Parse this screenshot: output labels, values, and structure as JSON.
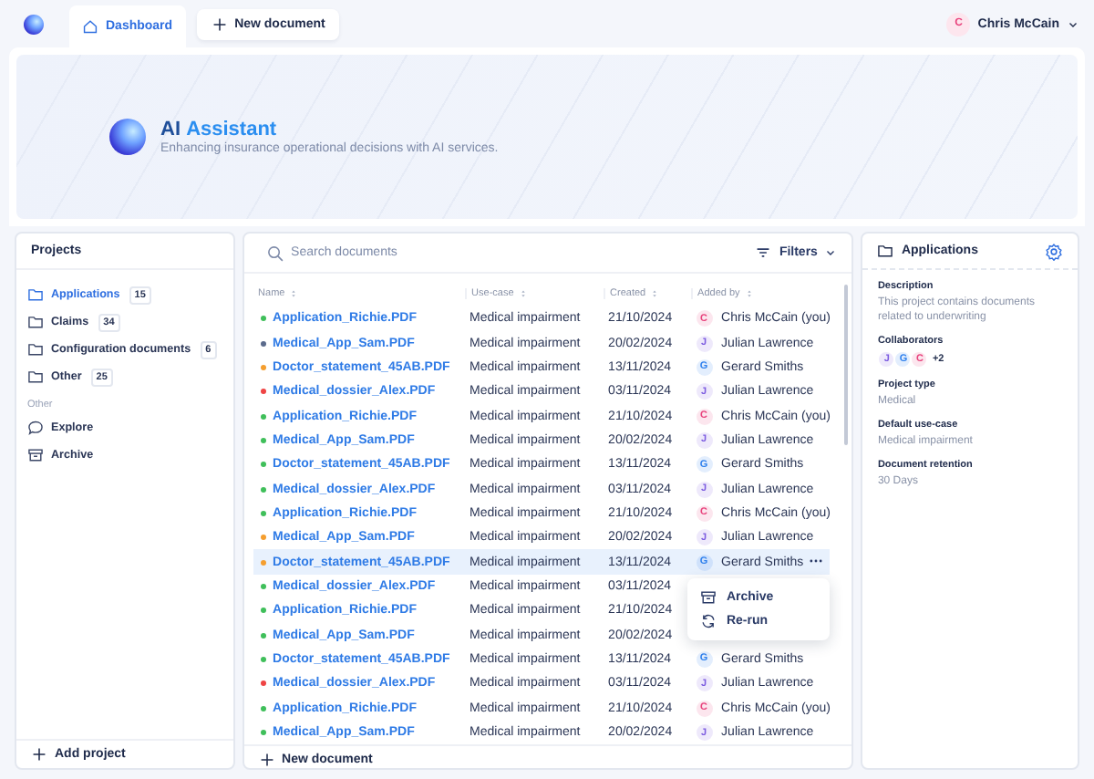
{
  "topbar": {
    "tabs": [
      {
        "label": "Dashboard",
        "selected": true
      }
    ],
    "new_button": "New document",
    "user": {
      "initial": "C",
      "name": "Chris McCain"
    }
  },
  "hero": {
    "title": "AI **Assistant**",
    "subtitle": "Enhancing insurance operational decisions with AI services."
  },
  "projects": {
    "title": "Projects",
    "items": [
      {
        "label": "Applications",
        "count": "15",
        "selected": true
      },
      {
        "label": "Claims",
        "count": "34",
        "selected": false
      },
      {
        "label": "Configuration documents",
        "count": "6",
        "selected": false
      },
      {
        "label": "Other",
        "count": "25",
        "selected": false
      }
    ],
    "other_heading": "Other",
    "other_items": [
      {
        "kind": "explore",
        "label": "Explore"
      },
      {
        "kind": "archive",
        "label": "Archive"
      }
    ],
    "add_button": "Add project"
  },
  "documents": {
    "search": {
      "placeholder": "Search documents"
    },
    "filters": "Filters",
    "columns": [
      "Name",
      "Use-case",
      "Created",
      "Added by"
    ],
    "rows": [
      {
        "name": "Application_Richie.PDF",
        "color": "#3fbf5a",
        "use_case": "Medical impairment",
        "created": "21/10/2024",
        "added_by": {
          "initial": "C",
          "name": "Chris McCain (you)",
          "color": "#e8427c"
        },
        "selected": false
      },
      {
        "name": "Medical_App_Sam.PDF",
        "color": "#5b6b8c",
        "use_case": "Medical impairment",
        "created": "20/02/2024",
        "added_by": {
          "initial": "J",
          "name": "Julian Lawrence",
          "color": "#7c5ce0"
        },
        "selected": false
      },
      {
        "name": "Doctor_statement_45AB.PDF",
        "color": "#f59e2e",
        "use_case": "Medical impairment",
        "created": "13/11/2024",
        "added_by": {
          "initial": "G",
          "name": "Gerard Smiths",
          "color": "#2f80ed"
        },
        "selected": false
      },
      {
        "name": "Medical_dossier_Alex.PDF",
        "color": "#ef4444",
        "use_case": "Medical impairment",
        "created": "03/11/2024",
        "added_by": {
          "initial": "J",
          "name": "Julian Lawrence",
          "color": "#7c5ce0"
        },
        "selected": false
      },
      {
        "name": "Application_Richie.PDF",
        "color": "#3fbf5a",
        "use_case": "Medical impairment",
        "created": "21/10/2024",
        "added_by": {
          "initial": "C",
          "name": "Chris McCain (you)",
          "color": "#e8427c"
        },
        "selected": false
      },
      {
        "name": "Medical_App_Sam.PDF",
        "color": "#3fbf5a",
        "use_case": "Medical impairment",
        "created": "20/02/2024",
        "added_by": {
          "initial": "J",
          "name": "Julian Lawrence",
          "color": "#7c5ce0"
        },
        "selected": false
      },
      {
        "name": "Doctor_statement_45AB.PDF",
        "color": "#3fbf5a",
        "use_case": "Medical impairment",
        "created": "13/11/2024",
        "added_by": {
          "initial": "G",
          "name": "Gerard Smiths",
          "color": "#2f80ed"
        },
        "selected": false
      },
      {
        "name": "Medical_dossier_Alex.PDF",
        "color": "#3fbf5a",
        "use_case": "Medical impairment",
        "created": "03/11/2024",
        "added_by": {
          "initial": "J",
          "name": "Julian Lawrence",
          "color": "#7c5ce0"
        },
        "selected": false
      },
      {
        "name": "Application_Richie.PDF",
        "color": "#3fbf5a",
        "use_case": "Medical impairment",
        "created": "21/10/2024",
        "added_by": {
          "initial": "C",
          "name": "Chris McCain (you)",
          "color": "#e8427c"
        },
        "selected": false
      },
      {
        "name": "Medical_App_Sam.PDF",
        "color": "#f59e2e",
        "use_case": "Medical impairment",
        "created": "20/02/2024",
        "added_by": {
          "initial": "J",
          "name": "Julian Lawrence",
          "color": "#7c5ce0"
        },
        "selected": false
      },
      {
        "name": "Doctor_statement_45AB.PDF",
        "color": "#f59e2e",
        "use_case": "Medical impairment",
        "created": "13/11/2024",
        "added_by": {
          "initial": "G",
          "name": "Gerard Smiths",
          "color": "#2f80ed"
        },
        "selected": true
      },
      {
        "name": "Medical_dossier_Alex.PDF",
        "color": "#3fbf5a",
        "use_case": "Medical impairment",
        "created": "03/11/2024",
        "selected": false
      },
      {
        "name": "Application_Richie.PDF",
        "color": "#3fbf5a",
        "use_case": "Medical impairment",
        "created": "21/10/2024",
        "selected": false
      },
      {
        "name": "Medical_App_Sam.PDF",
        "color": "#3fbf5a",
        "use_case": "Medical impairment",
        "created": "20/02/2024",
        "selected": false
      },
      {
        "name": "Doctor_statement_45AB.PDF",
        "color": "#3fbf5a",
        "use_case": "Medical impairment",
        "created": "13/11/2024",
        "added_by": {
          "initial": "G",
          "name": "Gerard Smiths",
          "color": "#2f80ed"
        },
        "selected": false
      },
      {
        "name": "Medical_dossier_Alex.PDF",
        "color": "#ef4444",
        "use_case": "Medical impairment",
        "created": "03/11/2024",
        "added_by": {
          "initial": "J",
          "name": "Julian Lawrence",
          "color": "#7c5ce0"
        },
        "selected": false
      },
      {
        "name": "Application_Richie.PDF",
        "color": "#3fbf5a",
        "use_case": "Medical impairment",
        "created": "21/10/2024",
        "added_by": {
          "initial": "C",
          "name": "Chris McCain (you)",
          "color": "#e8427c"
        },
        "selected": false
      },
      {
        "name": "Medical_App_Sam.PDF",
        "color": "#3fbf5a",
        "use_case": "Medical impairment",
        "created": "20/02/2024",
        "added_by": {
          "initial": "J",
          "name": "Julian Lawrence",
          "color": "#7c5ce0"
        },
        "selected": false
      }
    ],
    "row_menu": [
      {
        "kind": "archive",
        "label": "Archive"
      },
      {
        "kind": "rerun",
        "label": "Re-run"
      }
    ],
    "new_button": "New document"
  },
  "details": {
    "title": "Applications",
    "description_label": "Description",
    "description": "This project contains documents related to underwriting",
    "collaborators_label": "Collaborators",
    "collaborators": [
      {
        "initial": "J",
        "color": "#7c5ce0"
      },
      {
        "initial": "G",
        "color": "#2f80ed"
      },
      {
        "initial": "C",
        "color": "#e8427c"
      }
    ],
    "collaborators_more": "+2",
    "fields": [
      {
        "label": "Project type",
        "value": "Medical"
      },
      {
        "label": "Default use-case",
        "value": "Medical impairment"
      },
      {
        "label": "Document retention",
        "value": "30 Days"
      }
    ]
  }
}
